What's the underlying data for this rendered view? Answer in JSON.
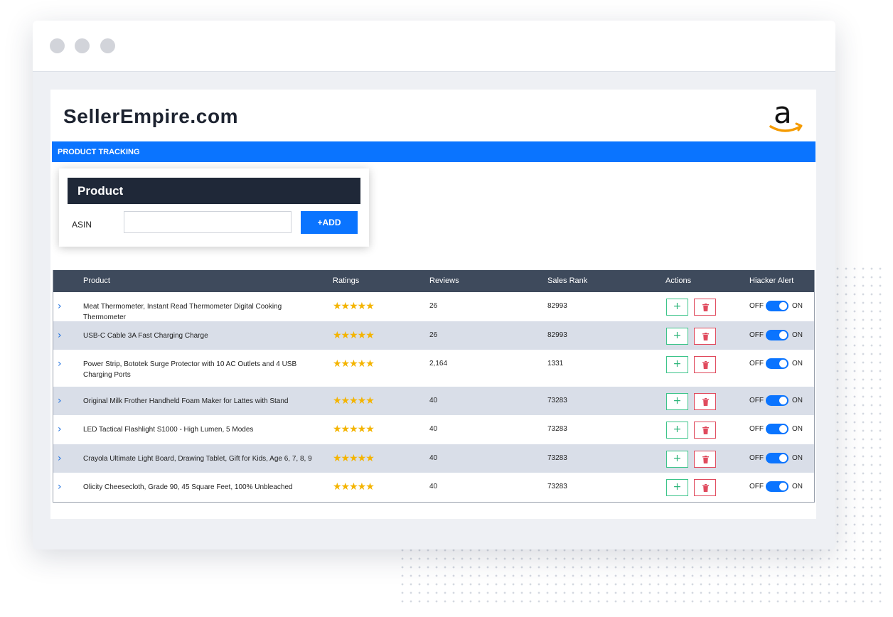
{
  "brand": {
    "name": "SellerEmpire.com",
    "logo": "amazon-logo"
  },
  "section_title": "PRODUCT TRACKING",
  "product_card": {
    "title": "Product",
    "asin_label": "ASIN",
    "asin_value": "",
    "add_label": "+ADD"
  },
  "table": {
    "headers": {
      "product": "Product",
      "ratings": "Ratings",
      "reviews": "Reviews",
      "sales_rank": "Sales Rank",
      "actions": "Actions",
      "alert": "Hiacker Alert"
    },
    "toggle": {
      "off": "OFF",
      "on": "ON"
    },
    "rows": [
      {
        "product": "Meat Thermometer, Instant Read Thermometer Digital Cooking Thermometer",
        "stars": 5,
        "reviews": "26",
        "sales_rank": "82993",
        "alert_on": true
      },
      {
        "product": "USB-C Cable 3A Fast Charging Charge",
        "stars": 5,
        "reviews": "26",
        "sales_rank": "82993",
        "alert_on": true
      },
      {
        "product": "Power Strip, Bototek Surge Protector with 10 AC Outlets and 4 USB Charging Ports",
        "stars": 5,
        "reviews": "2,164",
        "sales_rank": "1331",
        "alert_on": true
      },
      {
        "product": "Original Milk Frother Handheld Foam Maker for Lattes with Stand",
        "stars": 5,
        "reviews": "40",
        "sales_rank": "73283",
        "alert_on": true
      },
      {
        "product": "LED Tactical Flashlight S1000 - High Lumen, 5 Modes",
        "stars": 5,
        "reviews": "40",
        "sales_rank": "73283",
        "alert_on": true
      },
      {
        "product": "Crayola Ultimate Light Board, Drawing Tablet, Gift for Kids, Age 6, 7, 8, 9",
        "stars": 5,
        "reviews": "40",
        "sales_rank": "73283",
        "alert_on": true
      },
      {
        "product": "Olicity Cheesecloth, Grade 90, 45 Square Feet, 100% Unbleached",
        "stars": 5,
        "reviews": "40",
        "sales_rank": "73283",
        "alert_on": true
      }
    ]
  },
  "colors": {
    "accent": "#0a74ff",
    "header_dark": "#1f2838",
    "table_head": "#3e4a5c",
    "row_shade": "#d9dee8",
    "star": "#f4b400",
    "add_green": "#2db57a",
    "delete_red": "#e04a5d"
  }
}
